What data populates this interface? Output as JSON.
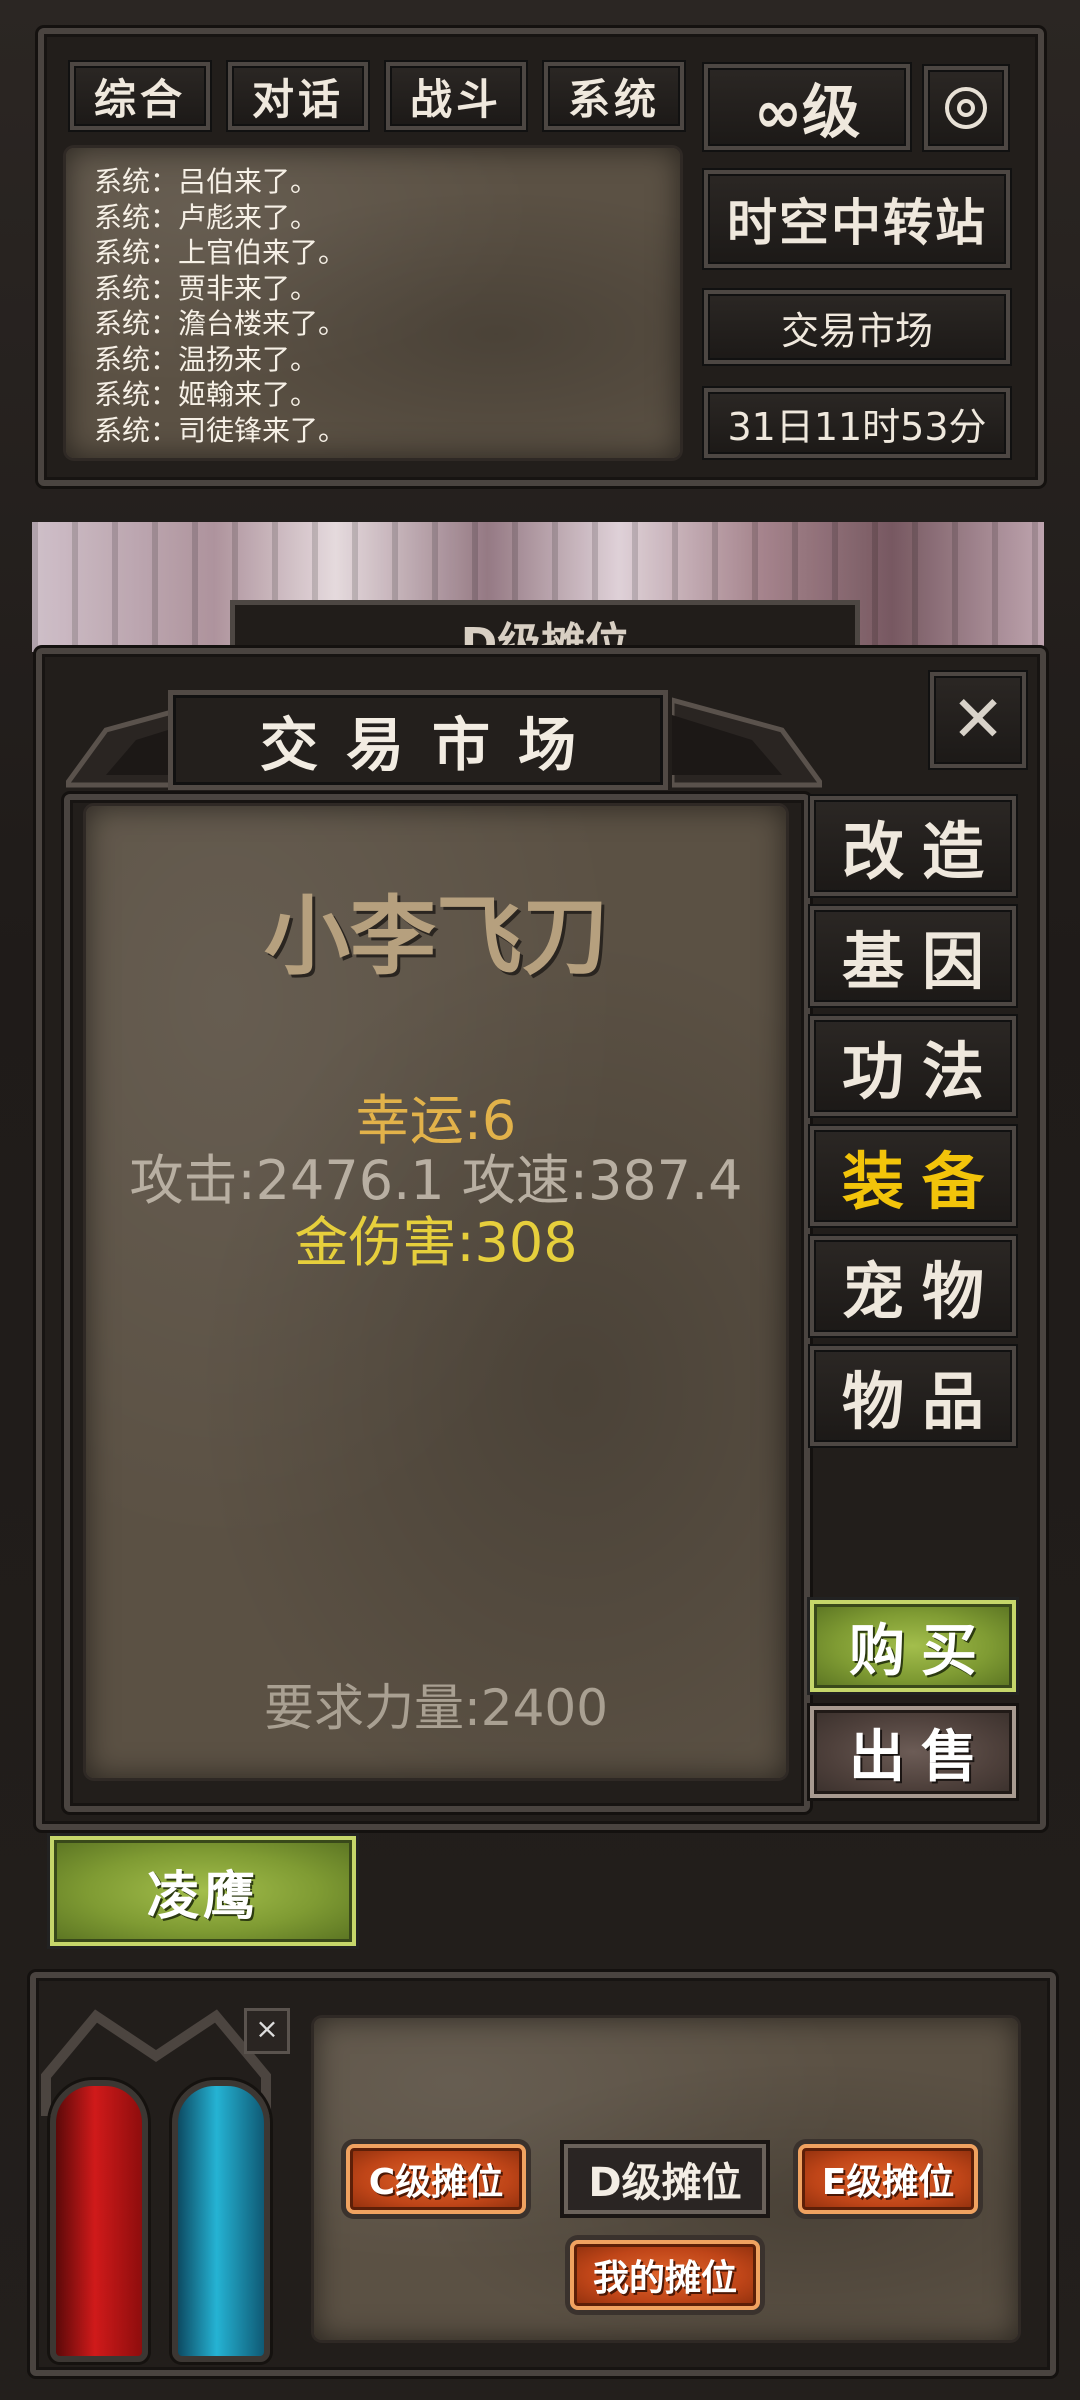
{
  "chat": {
    "tabs": [
      "综合",
      "对话",
      "战斗",
      "系统"
    ],
    "lines": [
      "系统：吕伯来了。",
      "系统：卢彪来了。",
      "系统：上官伯来了。",
      "系统：贾非来了。",
      "系统：澹台楼来了。",
      "系统：温扬来了。",
      "系统：姬翰来了。",
      "系统：司徒锋来了。"
    ]
  },
  "status": {
    "level": "∞级",
    "location": "时空中转站",
    "place": "交易市场",
    "time": "31日11时53分"
  },
  "background_tab": "D级摊位",
  "dialog": {
    "title": "交易市场",
    "close": "✕"
  },
  "item": {
    "name": "小李飞刀",
    "luck": "幸运:6",
    "attack": "攻击:2476.1 攻速:387.4",
    "gold_damage": "金伤害:308",
    "requirement": "要求力量:2400"
  },
  "categories": [
    "改造",
    "基因",
    "功法",
    "装备",
    "宠物",
    "物品"
  ],
  "selected_category": "装备",
  "actions": {
    "buy": "购买",
    "sell": "出售"
  },
  "seller": "凌鹰",
  "stalls": {
    "close": "×",
    "c": "C级摊位",
    "d": "D级摊位",
    "e": "E级摊位",
    "mine": "我的摊位"
  },
  "colors": {
    "luck": "#e2b24a",
    "gold_damage": "#e6cf3c",
    "attack": "#b8afa2",
    "selected_category": "#f2c40a",
    "category": "#efe8dd"
  }
}
